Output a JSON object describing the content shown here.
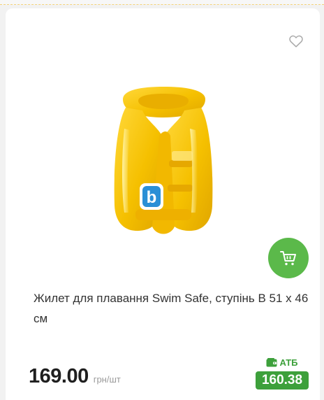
{
  "product": {
    "title": "Жилет для плавання Swim Safe, ступінь B 51 х 46 см",
    "price": "169.00",
    "unit": "грн/шт",
    "club_label": "АТБ",
    "club_price": "160.38",
    "image_badge_letter": "b"
  },
  "icons": {
    "favorite": "heart-outline-icon",
    "cart": "shopping-cart-icon",
    "club": "wallet-icon"
  },
  "colors": {
    "accent_green": "#5bb94a",
    "club_green": "#3da03b",
    "vest_yellow": "#f5c400"
  }
}
